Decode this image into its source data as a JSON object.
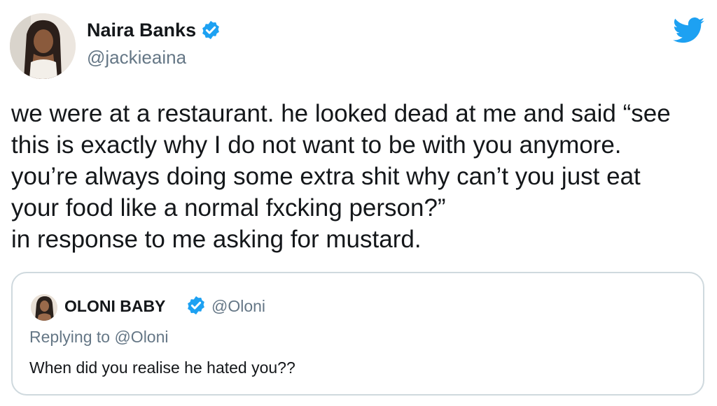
{
  "author": {
    "display_name": "Naira Banks",
    "handle": "@jackieaina",
    "verified": true,
    "avatar_icon": "profile-photo"
  },
  "tweet": {
    "text_lines": [
      "we were at a restaurant. he looked dead at me and said “see",
      "this is exactly why I do not want to be with you anymore.",
      "you’re always doing some extra shit why can’t you just eat",
      "your food like a normal fxcking person?”",
      "in response to me asking for mustard."
    ]
  },
  "quoted_tweet": {
    "display_name": "OLONI BABY",
    "handle": "@Oloni",
    "verified": true,
    "replying_to": "Replying to @Oloni",
    "text": "When did you realise he hated you??"
  },
  "icons": {
    "brand": "twitter-bird-icon",
    "verified": "verified-badge-icon"
  },
  "colors": {
    "twitter_blue": "#1da1f2",
    "text_primary": "#14171a",
    "text_secondary": "#657786",
    "border": "#cfd9de",
    "background": "#ffffff"
  }
}
